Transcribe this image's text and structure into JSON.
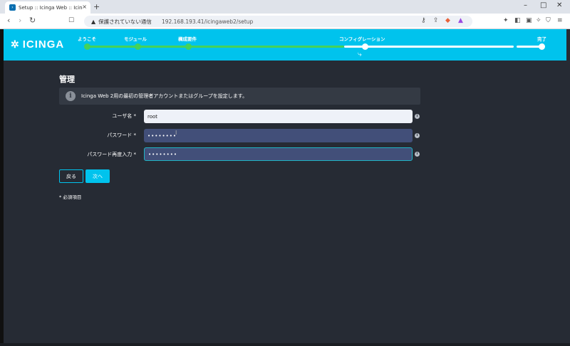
{
  "browser": {
    "tab_title": "Setup :: Icinga Web :: Icinga Web",
    "tab_close": "×",
    "new_tab": "+",
    "insecure_label": "保護されていない通信",
    "url": "192.168.193.41/icingaweb2/setup",
    "warn_icon": "▲",
    "window_controls": [
      "–",
      "□",
      "✕"
    ]
  },
  "header": {
    "logo_text": "icinga",
    "steps": [
      {
        "label": "ようこそ",
        "status": "done"
      },
      {
        "label": "モジュール",
        "status": "done"
      },
      {
        "label": "構成要件",
        "status": "done"
      },
      {
        "label": "コンフィグレーション",
        "status": "current"
      },
      {
        "label": "完了",
        "status": "pending"
      }
    ],
    "colors": {
      "bar": "#00c3ed",
      "done": "#44d25a",
      "current": "#ffffff"
    }
  },
  "main": {
    "title": "管理",
    "info_icon": "i",
    "info_text": "Icinga Web 2用の最初の管理者アカウントまたはグループを設定します。",
    "fields": [
      {
        "label": "ユーザ名 *",
        "value": "root"
      },
      {
        "label": "パスワード *",
        "value": "••••••••"
      },
      {
        "label": "パスワード再度入力 *",
        "value": "••••••••"
      }
    ],
    "hint_icon": "i",
    "back_label": "戻る",
    "next_label": "次へ",
    "required_note": "* 必須項目"
  }
}
